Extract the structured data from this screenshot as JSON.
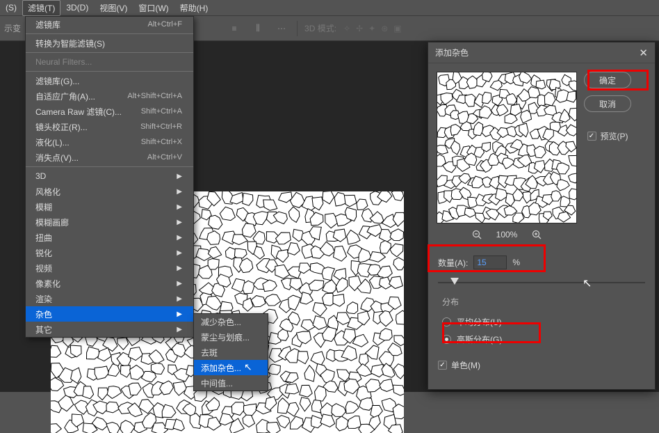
{
  "menubar": {
    "items": [
      {
        "label": "(S)"
      },
      {
        "label": "滤镜(T)",
        "active": true
      },
      {
        "label": "3D(D)"
      },
      {
        "label": "视图(V)"
      },
      {
        "label": "窗口(W)"
      },
      {
        "label": "帮助(H)"
      }
    ]
  },
  "optionsbar": {
    "label": "示变",
    "mode3d": "3D 模式:"
  },
  "filter_menu": {
    "last": {
      "label": "滤镜库",
      "shortcut": "Alt+Ctrl+F"
    },
    "smart": {
      "label": "转换为智能滤镜(S)"
    },
    "neural": {
      "label": "Neural Filters..."
    },
    "gallery": {
      "label": "滤镜库(G)...",
      "shortcut": ""
    },
    "adaptive": {
      "label": "自适应广角(A)...",
      "shortcut": "Alt+Shift+Ctrl+A"
    },
    "cameraraw": {
      "label": "Camera Raw 滤镜(C)...",
      "shortcut": "Shift+Ctrl+A"
    },
    "lens": {
      "label": "镜头校正(R)...",
      "shortcut": "Shift+Ctrl+R"
    },
    "liquify": {
      "label": "液化(L)...",
      "shortcut": "Shift+Ctrl+X"
    },
    "vanish": {
      "label": "消失点(V)...",
      "shortcut": "Alt+Ctrl+V"
    },
    "cat_3d": {
      "label": "3D"
    },
    "cat_stylize": {
      "label": "风格化"
    },
    "cat_blur": {
      "label": "模糊"
    },
    "cat_blurgal": {
      "label": "模糊画廊"
    },
    "cat_distort": {
      "label": "扭曲"
    },
    "cat_sharpen": {
      "label": "锐化"
    },
    "cat_video": {
      "label": "视频"
    },
    "cat_pixelate": {
      "label": "像素化"
    },
    "cat_render": {
      "label": "渲染"
    },
    "cat_noise": {
      "label": "杂色"
    },
    "cat_other": {
      "label": "其它"
    }
  },
  "noise_submenu": {
    "reduce": "减少杂色...",
    "dust": "蒙尘与划痕...",
    "despeckle": "去斑",
    "addnoise": "添加杂色...",
    "median": "中间值..."
  },
  "dialog": {
    "title": "添加杂色",
    "ok": "确定",
    "cancel": "取消",
    "preview": "预览(P)",
    "zoom": "100%",
    "amount_label": "数量(A):",
    "amount_value": "15",
    "percent": "%",
    "dist_title": "分布",
    "uniform": "平均分布(U)",
    "gaussian": "高斯分布(G)",
    "mono": "单色(M)"
  }
}
